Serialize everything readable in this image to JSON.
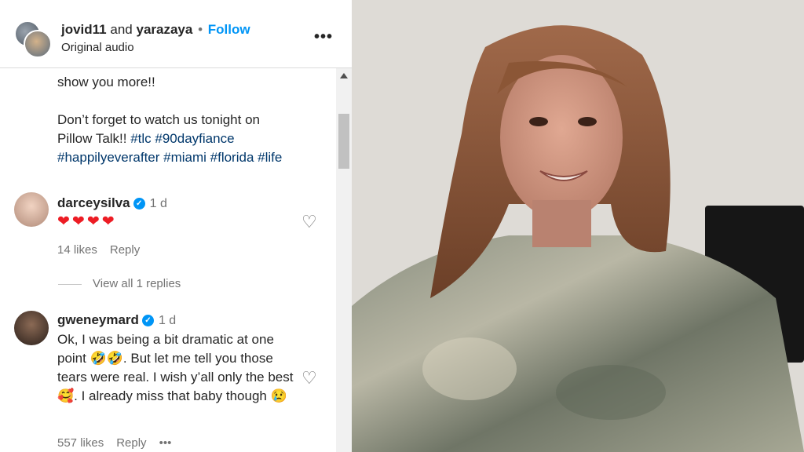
{
  "header": {
    "user1": "jovid11",
    "and": "and",
    "user2": "yarazaya",
    "separator": "•",
    "follow": "Follow",
    "audio": "Original audio",
    "more": "•••"
  },
  "caption": {
    "line1": "show you more!!",
    "line2": "Don’t forget to watch us tonight on",
    "line3_text": "Pillow Talk!! ",
    "tags_line3": "#tlc #90dayfiance",
    "tags_line4": "#happilyeverafter #miami #florida #life"
  },
  "comments": [
    {
      "username": "darceysilva",
      "time": "1 d",
      "text": "❤❤❤❤",
      "likes": "14 likes",
      "reply": "Reply"
    },
    {
      "username": "gweneymard",
      "time": "1 d",
      "text": "Ok, I was being a bit dramatic at one point 🤣🤣. But let me tell you those tears were real. I wish y’all only the best 🥰. I already miss that baby though 😢",
      "likes": "557 likes",
      "reply": "Reply",
      "more": "•••"
    }
  ],
  "view_replies": "View all 1 replies",
  "icons": {
    "verified": "verified-badge-icon",
    "heart": "heart-icon",
    "more": "more-options-icon"
  },
  "colors": {
    "follow_blue": "#0095f6",
    "hashtag": "#00376b",
    "meta_gray": "#737373"
  }
}
